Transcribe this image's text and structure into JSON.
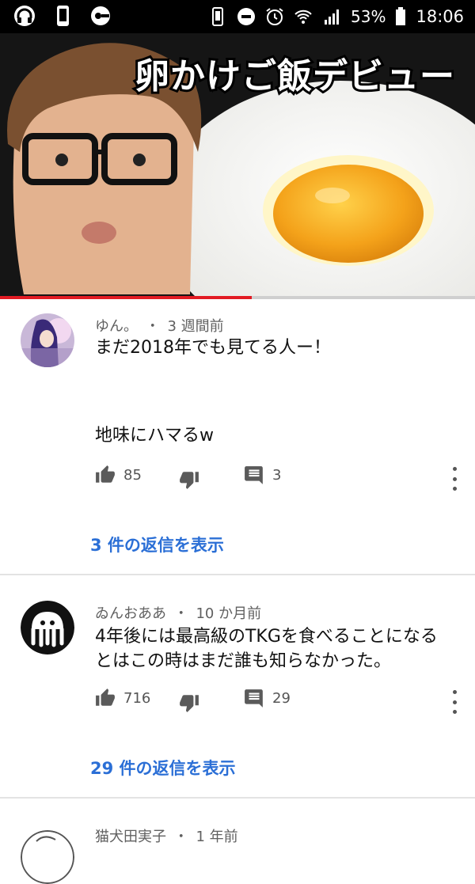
{
  "status_bar": {
    "battery": "53%",
    "time": "18:06",
    "icons": [
      "headset-icon",
      "phone-icon",
      "app-icon",
      "device-icon",
      "dnd-icon",
      "alarm-icon",
      "wifi-icon",
      "signal-icon",
      "battery-icon"
    ]
  },
  "video": {
    "thumbnail_title": "卵かけご飯デビュー",
    "progress": 0.53
  },
  "comments": [
    {
      "author": "ゆん。",
      "time": "3 週間前",
      "text_line1": "まだ2018年でも見てる人ー！",
      "text_line2": "地味にハマるw",
      "likes": "85",
      "reply_count": "3",
      "replies_link": "3 件の返信を表示"
    },
    {
      "author": "ゐんおああ",
      "time": "10 か月前",
      "text_line1": "4年後には最高級のTKGを食べることになる",
      "text_line2": "とはこの時はまだ誰も知らなかった。",
      "likes": "716",
      "reply_count": "29",
      "replies_link": "29 件の返信を表示"
    },
    {
      "author": "猫犬田実子",
      "time": "1 年前"
    }
  ],
  "separator": "・"
}
